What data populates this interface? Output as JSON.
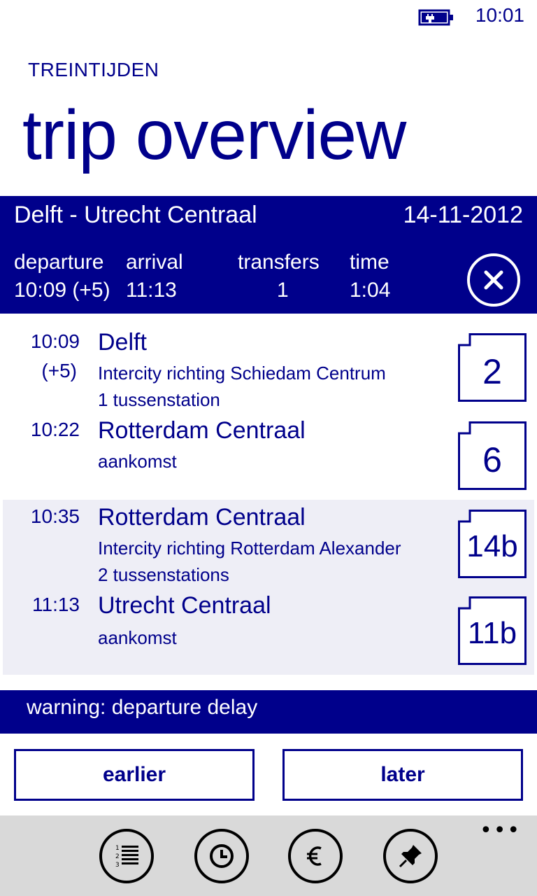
{
  "status": {
    "time": "10:01"
  },
  "app": {
    "title": "TREINTIJDEN",
    "page_title": "trip overview"
  },
  "trip": {
    "route": "Delft - Utrecht Centraal",
    "date": "14-11-2012",
    "labels": {
      "departure": "departure",
      "arrival": "arrival",
      "transfers": "transfers",
      "time": "time"
    },
    "values": {
      "departure": "10:09 (+5)",
      "arrival": "11:13",
      "transfers": "1",
      "time": "1:04"
    }
  },
  "legs": [
    {
      "board": {
        "time": "10:09",
        "delay": "(+5)",
        "station": "Delft",
        "detail1": "Intercity richting Schiedam Centrum",
        "detail2": "1 tussenstation",
        "platform": "2"
      },
      "alight": {
        "time": "10:22",
        "station": "Rotterdam Centraal",
        "detail1": "aankomst",
        "platform": "6"
      }
    },
    {
      "board": {
        "time": "10:35",
        "station": "Rotterdam Centraal",
        "detail1": "Intercity richting Rotterdam Alexander",
        "detail2": "2 tussenstations",
        "platform": "14b"
      },
      "alight": {
        "time": "11:13",
        "station": "Utrecht Centraal",
        "detail1": "aankomst",
        "platform": "11b"
      }
    }
  ],
  "warning": "warning: departure delay",
  "buttons": {
    "earlier": "earlier",
    "later": "later"
  },
  "app_bar": {
    "more": "•••",
    "icons": [
      "list-icon",
      "clock-icon",
      "euro-icon",
      "pin-icon"
    ]
  },
  "colors": {
    "accent": "#00008b",
    "shade": "#eeeef6",
    "app_bar": "#d9d9d9"
  }
}
